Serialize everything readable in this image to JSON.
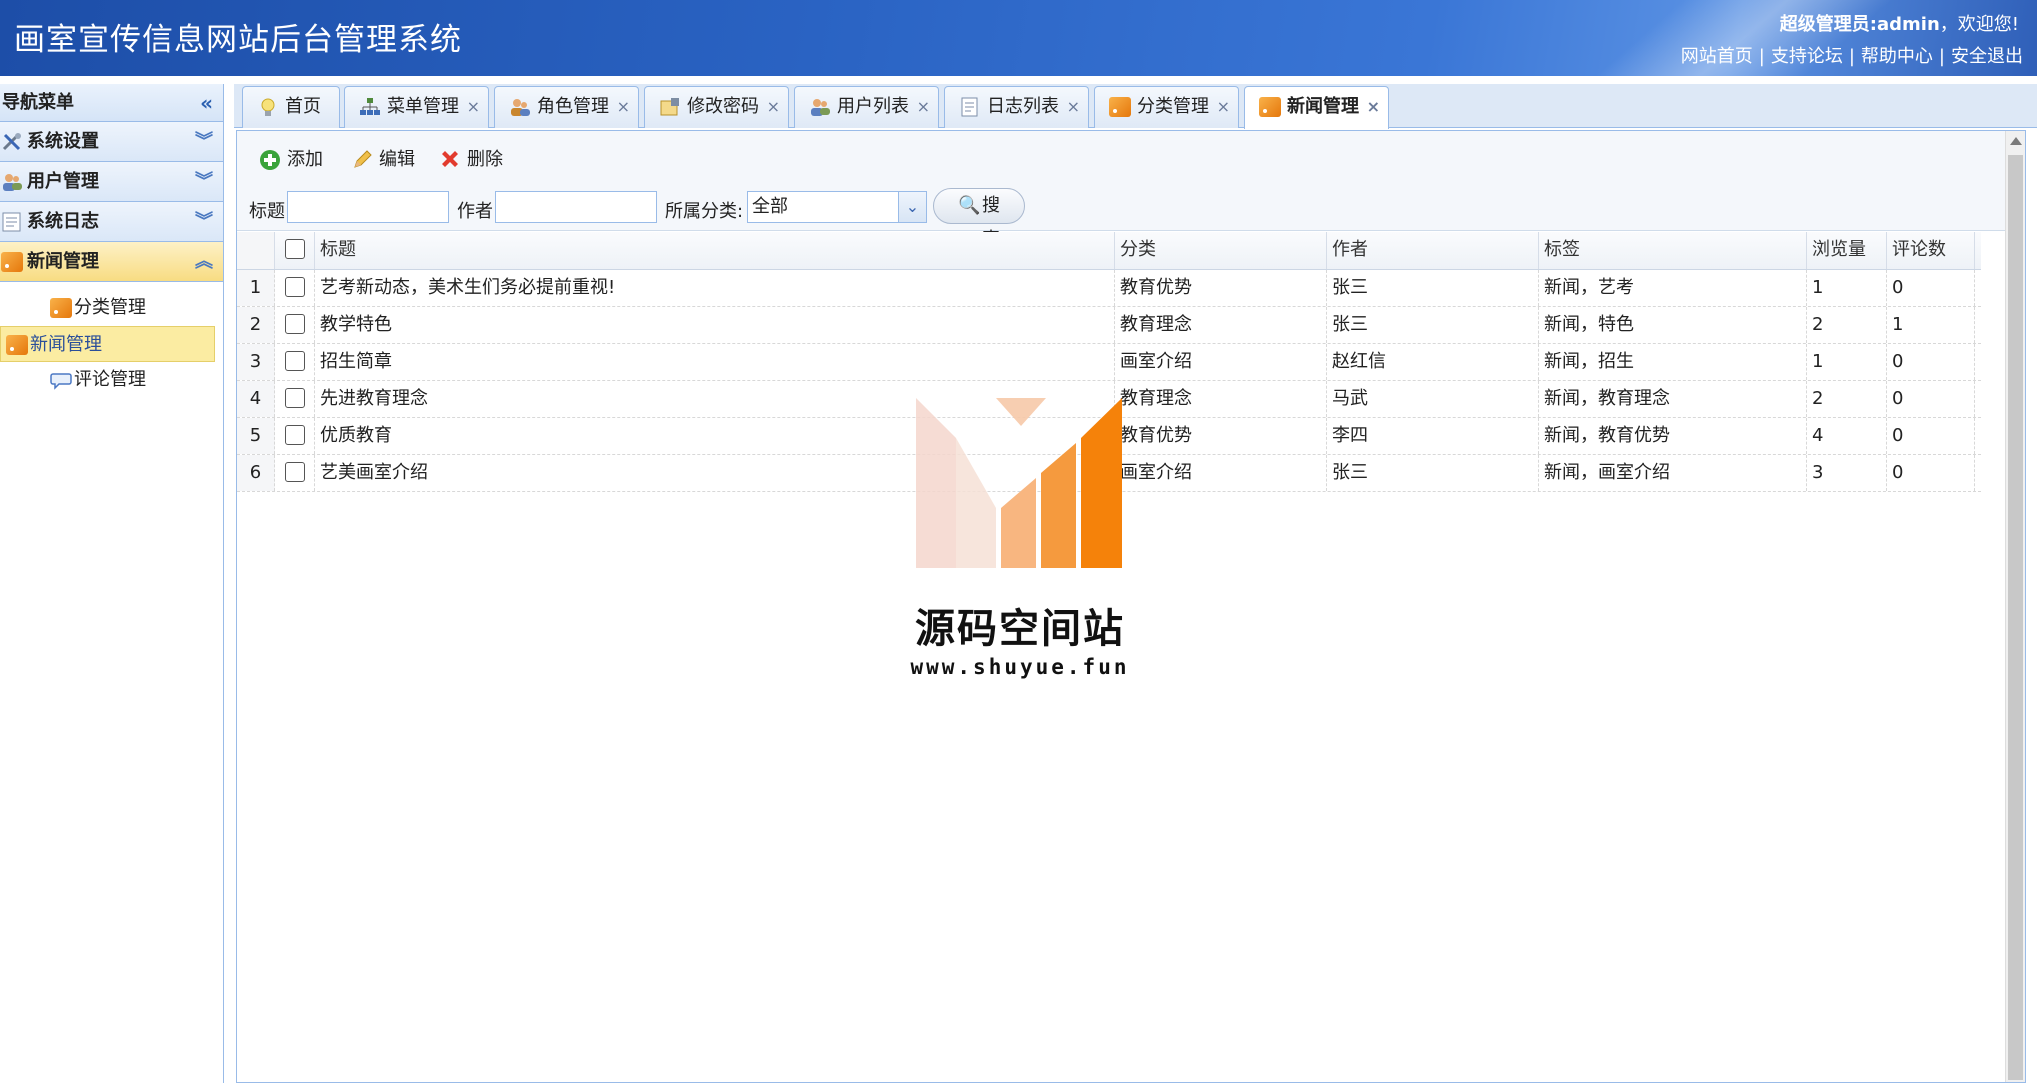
{
  "header": {
    "title": "画室宣传信息网站后台管理系统",
    "welcome_role": "超级管理员:admin",
    "welcome_suffix": "，欢迎您!",
    "links": [
      "网站首页",
      "支持论坛",
      "帮助中心",
      "安全退出"
    ],
    "link_separator": "|"
  },
  "sidebar": {
    "title": "导航菜单",
    "collapse_icon": "double-chevron-left",
    "sections": [
      {
        "label": "系统设置",
        "icon": "tools-icon",
        "expanded": false
      },
      {
        "label": "用户管理",
        "icon": "users-icon",
        "expanded": false
      },
      {
        "label": "系统日志",
        "icon": "log-icon",
        "expanded": false
      },
      {
        "label": "新闻管理",
        "icon": "rss-icon",
        "expanded": true
      }
    ],
    "sub_items": [
      {
        "label": "分类管理",
        "icon": "rss-icon",
        "selected": false
      },
      {
        "label": "新闻管理",
        "icon": "rss-icon",
        "selected": true
      },
      {
        "label": "评论管理",
        "icon": "comment-icon",
        "selected": false
      }
    ]
  },
  "tabs": [
    {
      "label": "首页",
      "icon": "lightbulb-icon",
      "closable": false
    },
    {
      "label": "菜单管理",
      "icon": "menu-tree-icon",
      "closable": true
    },
    {
      "label": "角色管理",
      "icon": "role-icon",
      "closable": true
    },
    {
      "label": "修改密码",
      "icon": "password-icon",
      "closable": true
    },
    {
      "label": "用户列表",
      "icon": "user-list-icon",
      "closable": true
    },
    {
      "label": "日志列表",
      "icon": "log-list-icon",
      "closable": true
    },
    {
      "label": "分类管理",
      "icon": "rss-icon",
      "closable": true
    },
    {
      "label": "新闻管理",
      "icon": "rss-icon",
      "closable": true,
      "active": true
    }
  ],
  "tab_close_glyph": "×",
  "toolbar": {
    "add": "添加",
    "edit": "编辑",
    "delete": "删除"
  },
  "search": {
    "title_label": "标题:",
    "title_value": "",
    "author_label": "作者:",
    "author_value": "",
    "category_label": "所属分类:",
    "category_value": "全部",
    "button": "搜索"
  },
  "table": {
    "columns": [
      "标题",
      "分类",
      "作者",
      "标签",
      "浏览量",
      "评论数"
    ],
    "rows": [
      {
        "num": "1",
        "title": "艺考新动态，美术生们务必提前重视!",
        "category": "教育优势",
        "author": "张三",
        "tags": "新闻，艺考",
        "views": "1",
        "comments": "0"
      },
      {
        "num": "2",
        "title": "教学特色",
        "category": "教育理念",
        "author": "张三",
        "tags": "新闻，特色",
        "views": "2",
        "comments": "1"
      },
      {
        "num": "3",
        "title": "招生简章",
        "category": "画室介绍",
        "author": "赵红信",
        "tags": "新闻，招生",
        "views": "1",
        "comments": "0"
      },
      {
        "num": "4",
        "title": "先进教育理念",
        "category": "教育理念",
        "author": "马武",
        "tags": "新闻，教育理念",
        "views": "2",
        "comments": "0"
      },
      {
        "num": "5",
        "title": "优质教育",
        "category": "教育优势",
        "author": "李四",
        "tags": "新闻，教育优势",
        "views": "4",
        "comments": "0"
      },
      {
        "num": "6",
        "title": "艺美画室介绍",
        "category": "画室介绍",
        "author": "张三",
        "tags": "新闻，画室介绍",
        "views": "3",
        "comments": "0"
      }
    ]
  },
  "watermark": {
    "name": "源码空间站",
    "url": "www.shuyue.fun",
    "colors": {
      "orange": "#f5820a",
      "light": "#f2c7b8"
    }
  },
  "colors": {
    "header_blue": "#1d4ea8",
    "border_blue": "#99bbe8",
    "active_yellow": "#f8dc82"
  }
}
